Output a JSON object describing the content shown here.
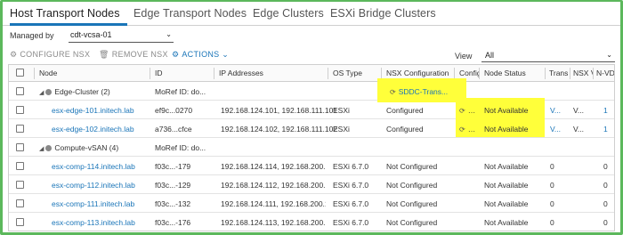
{
  "tabs": [
    {
      "label": "Host Transport Nodes",
      "active": true
    },
    {
      "label": "Edge Transport Nodes",
      "active": false
    },
    {
      "label": "Edge Clusters",
      "active": false
    },
    {
      "label": "ESXi Bridge Clusters",
      "active": false
    }
  ],
  "managed_by": {
    "label": "Managed by",
    "value": "cdt-vcsa-01"
  },
  "toolbar": {
    "configure": "CONFIGURE NSX",
    "remove": "REMOVE NSX",
    "actions": "ACTIONS"
  },
  "view": {
    "label": "View",
    "value": "All"
  },
  "columns": [
    "Node",
    "ID",
    "IP Addresses",
    "OS Type",
    "NSX Configuration",
    "Config",
    "Node Status",
    "Trans",
    "NSX V",
    "N-VD"
  ],
  "rows": [
    {
      "kind": "group",
      "node": "Edge-Cluster (2)",
      "id": "MoRef ID: do...",
      "ip": "",
      "os": "",
      "nsx": "SDDC-Trans...",
      "config": "",
      "status": "",
      "trans": "",
      "nsxv": "",
      "nvd": ""
    },
    {
      "kind": "host",
      "node": "esx-edge-101.initech.lab",
      "id": "ef9c...0270",
      "ip": "192.168.124.101, 192.168.111.101",
      "os": "ESXi",
      "nsx": "Configured",
      "config": "",
      "status": "Not Available",
      "trans": "V...",
      "nsxv": "V...",
      "nvd": "1"
    },
    {
      "kind": "host",
      "node": "esx-edge-102.initech.lab",
      "id": "a736...cfce",
      "ip": "192.168.124.102, 192.168.111.102",
      "os": "ESXi",
      "nsx": "Configured",
      "config": "",
      "status": "Not Available",
      "trans": "V...",
      "nsxv": "V...",
      "nvd": "1"
    },
    {
      "kind": "group",
      "node": "Compute-vSAN (4)",
      "id": "MoRef ID: do...",
      "ip": "",
      "os": "",
      "nsx": "",
      "config": "",
      "status": "",
      "trans": "",
      "nsxv": "",
      "nvd": ""
    },
    {
      "kind": "host",
      "node": "esx-comp-114.initech.lab",
      "id": "f03c...-179",
      "ip": "192.168.124.114, 192.168.200.1...",
      "os": "ESXi 6.7.0",
      "nsx": "Not Configured",
      "config": "",
      "status": "Not Available",
      "trans": "0",
      "nsxv": "",
      "nvd": "0"
    },
    {
      "kind": "host",
      "node": "esx-comp-112.initech.lab",
      "id": "f03c...-129",
      "ip": "192.168.124.112, 192.168.200.1...",
      "os": "ESXi 6.7.0",
      "nsx": "Not Configured",
      "config": "",
      "status": "Not Available",
      "trans": "0",
      "nsxv": "",
      "nvd": "0"
    },
    {
      "kind": "host",
      "node": "esx-comp-111.initech.lab",
      "id": "f03c...-132",
      "ip": "192.168.124.111, 192.168.200.11...",
      "os": "ESXi 6.7.0",
      "nsx": "Not Configured",
      "config": "",
      "status": "Not Available",
      "trans": "0",
      "nsxv": "",
      "nvd": "0"
    },
    {
      "kind": "host",
      "node": "esx-comp-113.initech.lab",
      "id": "f03c...-176",
      "ip": "192.168.124.113, 192.168.200.1...",
      "os": "ESXi 6.7.0",
      "nsx": "Not Configured",
      "config": "",
      "status": "Not Available",
      "trans": "0",
      "nsxv": "",
      "nvd": "0"
    }
  ],
  "colors": {
    "frame": "#5cb85c",
    "link": "#1a75b8",
    "highlight": "#ffff3a"
  }
}
